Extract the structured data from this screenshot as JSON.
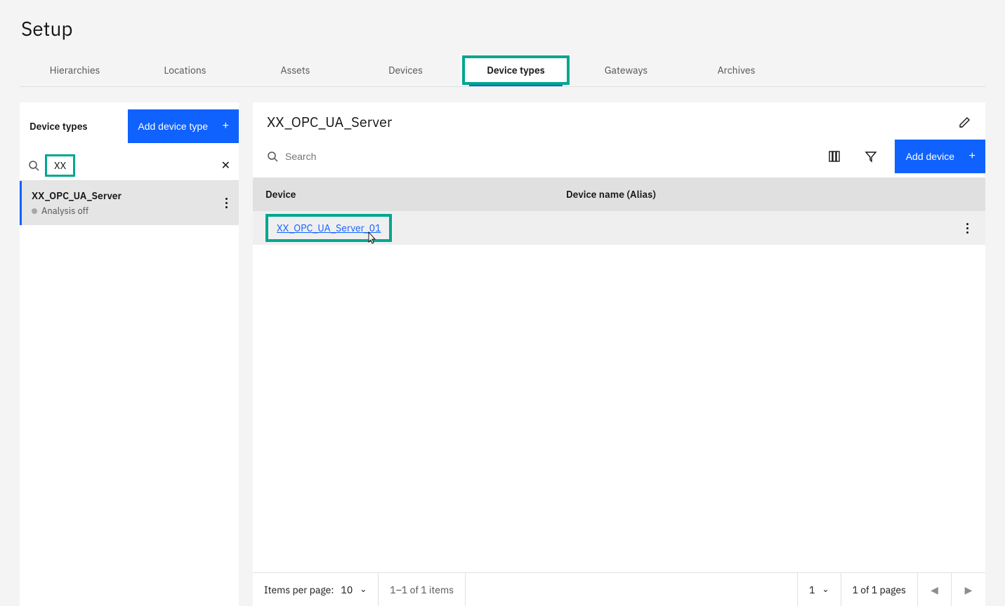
{
  "page_title": "Setup",
  "tabs": [
    "Hierarchies",
    "Locations",
    "Assets",
    "Devices",
    "Device types",
    "Gateways",
    "Archives"
  ],
  "active_tab_index": 4,
  "sidebar": {
    "title": "Device types",
    "add_button": "Add device type",
    "search_value": "XX",
    "item": {
      "name": "XX_OPC_UA_Server",
      "status": "Analysis off"
    }
  },
  "main": {
    "title": "XX_OPC_UA_Server",
    "search_placeholder": "Search",
    "add_button": "Add device",
    "columns": {
      "device": "Device",
      "alias": "Device name (Alias)"
    },
    "row": {
      "device": "XX_OPC_UA_Server_01"
    }
  },
  "pagination": {
    "items_per_page_label": "Items per page:",
    "items_per_page_value": "10",
    "range_text": "1–1 of 1 items",
    "page_value": "1",
    "pages_text": "1 of 1 pages"
  }
}
